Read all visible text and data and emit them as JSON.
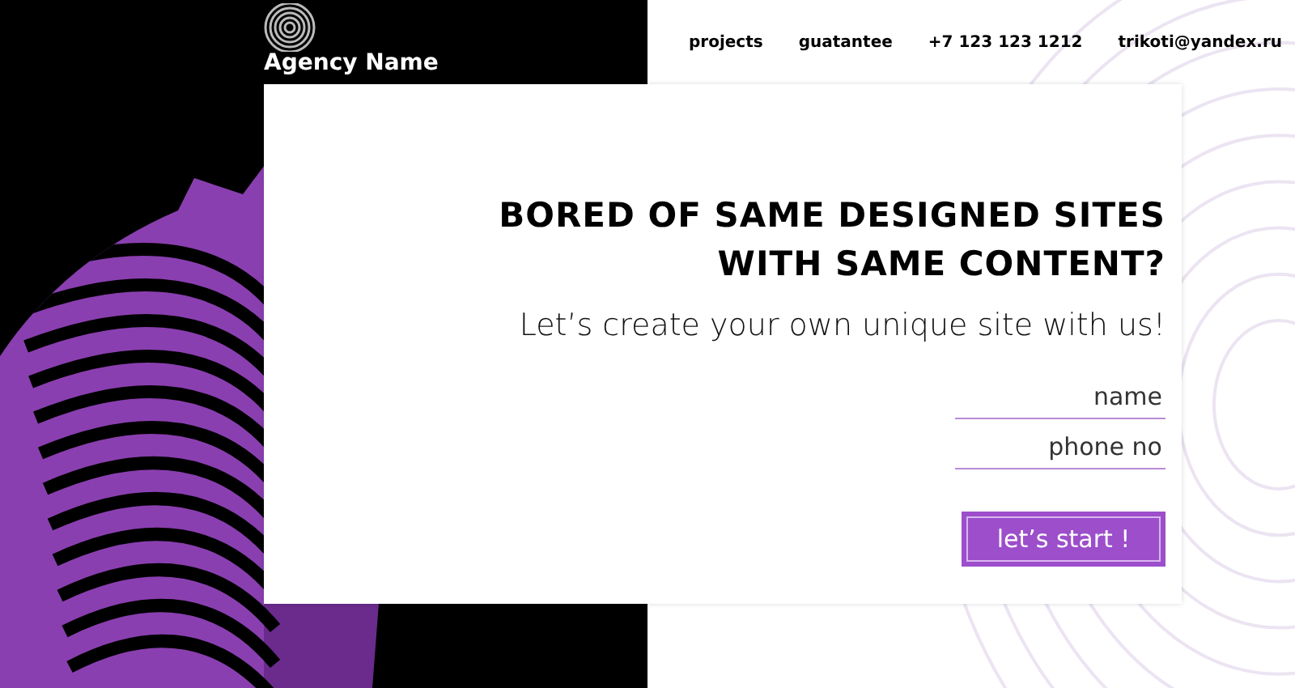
{
  "header": {
    "logo": "Agency Name",
    "nav": [
      "projects",
      "guatantee",
      "+7 123 123 1212",
      "trikoti@yandex.ru"
    ]
  },
  "hero": {
    "title_lines": [
      "BORED OF SAME DESIGNED SITES",
      "WITH SAME CONTENT?"
    ],
    "subtitle": "Let’s create your own unique site with us!",
    "fields": [
      {
        "placeholder": "name"
      },
      {
        "placeholder": "phone no"
      }
    ],
    "button": "let’s start !"
  }
}
